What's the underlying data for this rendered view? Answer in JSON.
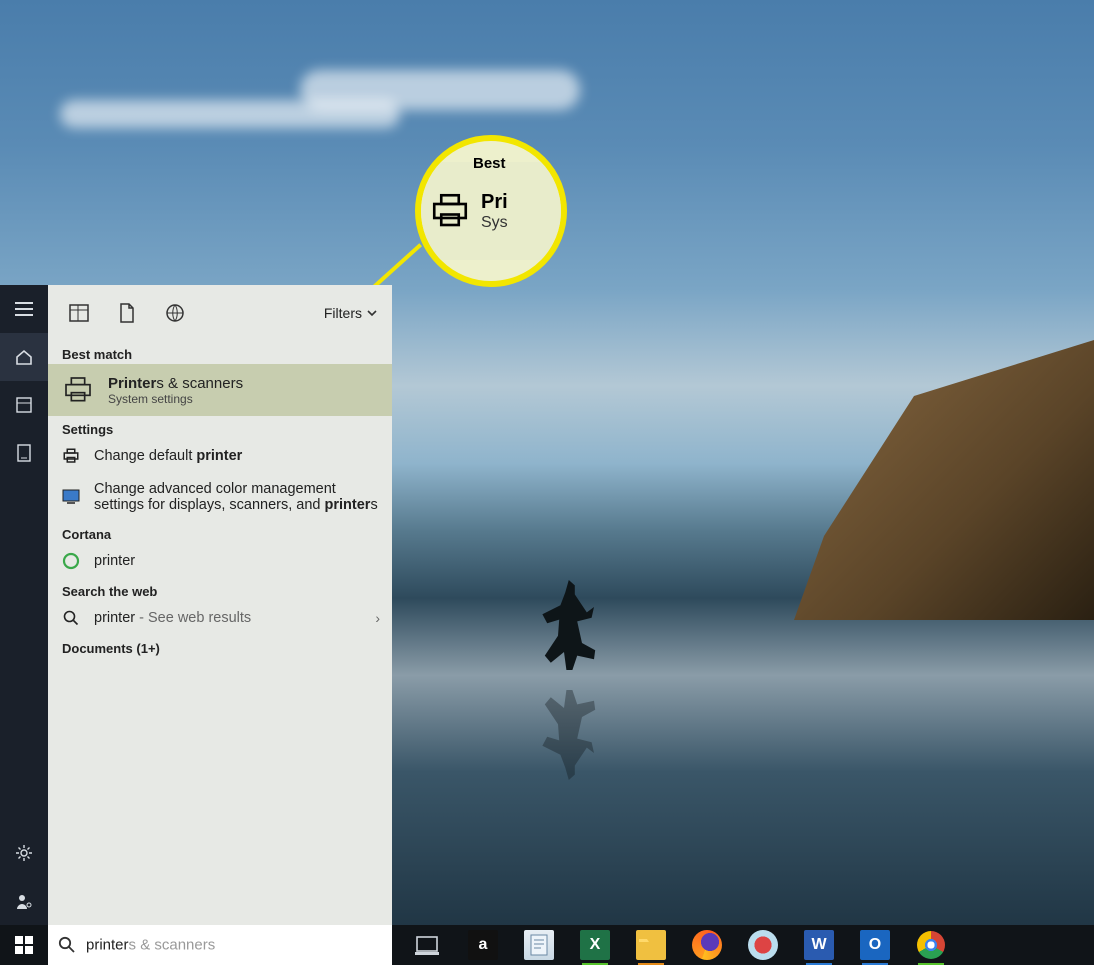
{
  "panel": {
    "filters_label": "Filters",
    "sections": {
      "best_match": "Best match",
      "settings": "Settings",
      "cortana": "Cortana",
      "web": "Search the web",
      "documents": "Documents (1+)"
    },
    "best_match": {
      "title_bold": "Printer",
      "title_rest": "s & scanners",
      "subtitle": "System settings"
    },
    "settings_items": [
      {
        "pre": "Change default ",
        "bold": "printer",
        "post": ""
      },
      {
        "pre": "Change advanced color management settings for displays, scanners, and ",
        "bold": "printer",
        "post": "s"
      }
    ],
    "cortana_item": "printer",
    "web_item": {
      "term": "printer",
      "suffix": " - See web results"
    }
  },
  "searchbox": {
    "typed": "printer",
    "placeholder_rest": "s & scanners"
  },
  "callout": {
    "top_label": "Best",
    "title_frag": "Pri",
    "sub_frag": "Sys"
  },
  "taskbar": {
    "apps": [
      "task-view",
      "amazon",
      "notepad",
      "excel",
      "file-explorer",
      "firefox",
      "spyder",
      "word",
      "outlook",
      "chrome"
    ]
  },
  "colors": {
    "highlight": "#c7cdaf",
    "callout_ring": "#f2e600"
  }
}
